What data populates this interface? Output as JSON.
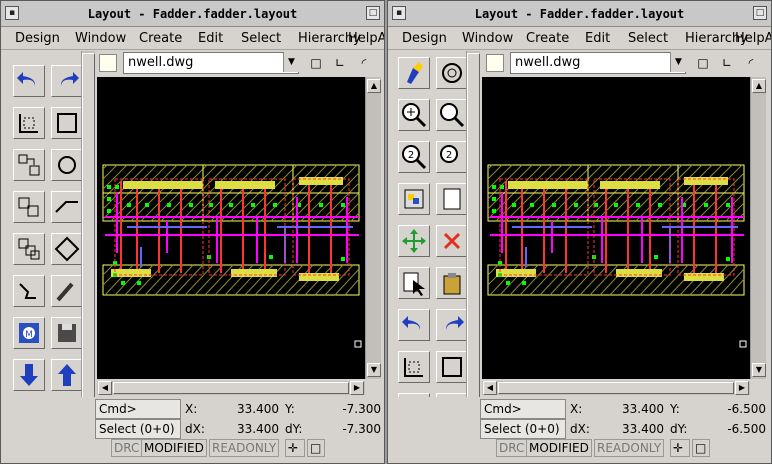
{
  "windows": [
    {
      "id": "left",
      "title": "Layout - Fadder.fadder.layout",
      "menu": [
        "Design",
        "Window",
        "Create",
        "Edit",
        "Select",
        "Hierarchy",
        "HelpA"
      ],
      "layer": "nwell.dwg",
      "status": {
        "cmd_label": "Cmd>",
        "select_label": "Select (0+0)",
        "x_label": "X:",
        "x_value": "33.400",
        "y_label": "Y:",
        "y_value": "-7.300",
        "dx_label": "dX:",
        "dx_value": "33.400",
        "dy_label": "dY:",
        "dy_value": "-7.300",
        "flags": [
          "DRC",
          "MODIFIED",
          "READONLY"
        ]
      }
    },
    {
      "id": "right",
      "title": "Layout - Fadder.fadder.layout",
      "menu": [
        "Design",
        "Window",
        "Create",
        "Edit",
        "Select",
        "Hierarchy",
        "HelpA"
      ],
      "layer": "nwell.dwg",
      "status": {
        "cmd_label": "Cmd>",
        "select_label": "Select (0+0)",
        "x_label": "X:",
        "x_value": "33.400",
        "y_label": "Y:",
        "y_value": "-6.500",
        "dx_label": "dX:",
        "dx_value": "33.400",
        "dy_label": "dY:",
        "dy_value": "-6.500",
        "flags": [
          "DRC",
          "MODIFIED",
          "READONLY"
        ]
      }
    }
  ],
  "colors": {
    "canvas": "#000000",
    "nwell": "#ffff66",
    "metal1": "#ff00ff",
    "poly": "#ff3333",
    "contact": "#00ff00",
    "diffusion": "#dddd44",
    "metal2": "#6666ff"
  }
}
